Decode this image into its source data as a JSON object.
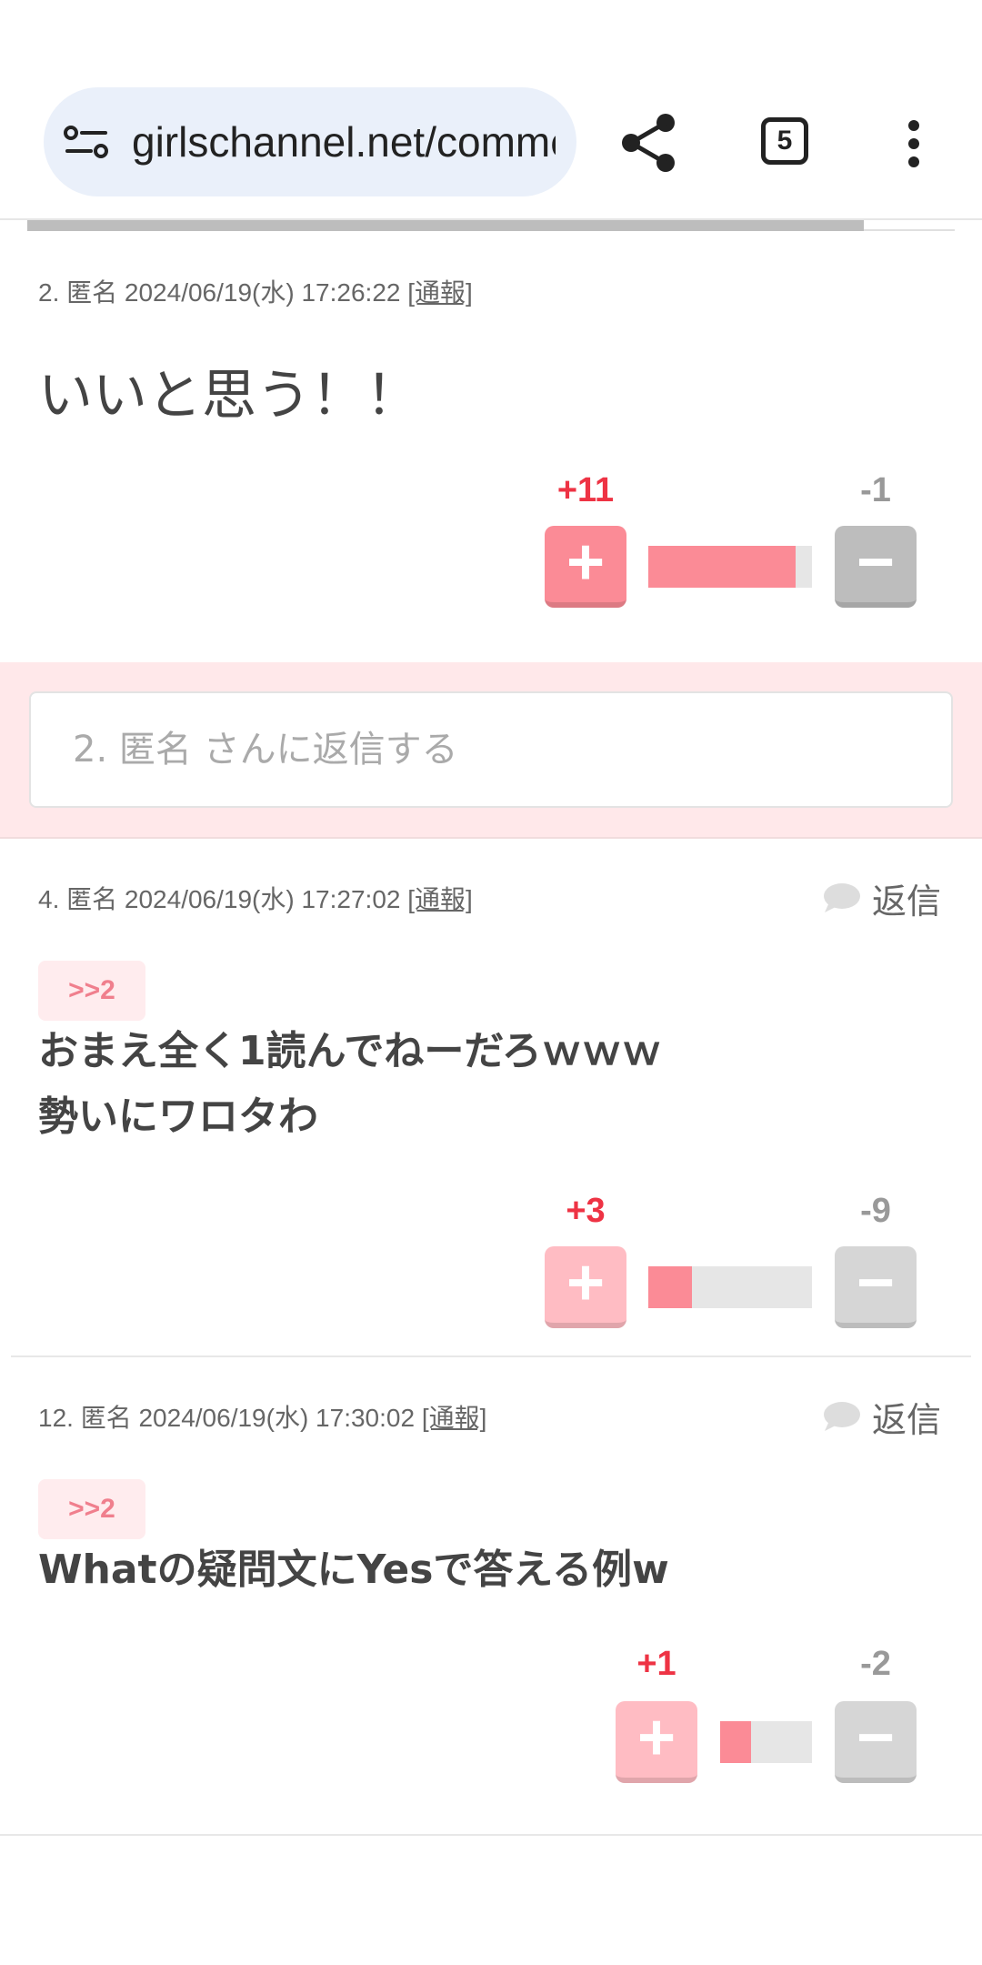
{
  "browser": {
    "url": "girlschannel.net/comment/",
    "tab_count": "5"
  },
  "comments": [
    {
      "meta": "2. 匿名 2024/06/19(水) 17:26:22 ",
      "report": "[通報]",
      "body": "いいと思う！！",
      "plus": "+11",
      "minus": "-1",
      "positive_ratio": 0.9
    },
    {
      "meta": "4. 匿名 2024/06/19(水) 17:27:02 ",
      "report": "[通報]",
      "reply_label": "返信",
      "quote": ">>2",
      "body_lines": [
        "おまえ全く1読んでねーだろｗｗｗ",
        "勢いにワロタわ"
      ],
      "plus": "+3",
      "minus": "-9",
      "positive_ratio": 0.25
    },
    {
      "meta": "12. 匿名 2024/06/19(水) 17:30:02 ",
      "report": "[通報]",
      "reply_label": "返信",
      "quote": ">>2",
      "body": "Whatの疑問文にYesで答える例w",
      "plus": "+1",
      "minus": "-2",
      "positive_ratio": 0.33
    }
  ],
  "reply_form": {
    "placeholder": "2. 匿名 さんに返信する"
  },
  "colors": {
    "accent_pink": "#fb8b96",
    "plus_red": "#ee3344",
    "minus_gray": "#bdbdbd"
  }
}
